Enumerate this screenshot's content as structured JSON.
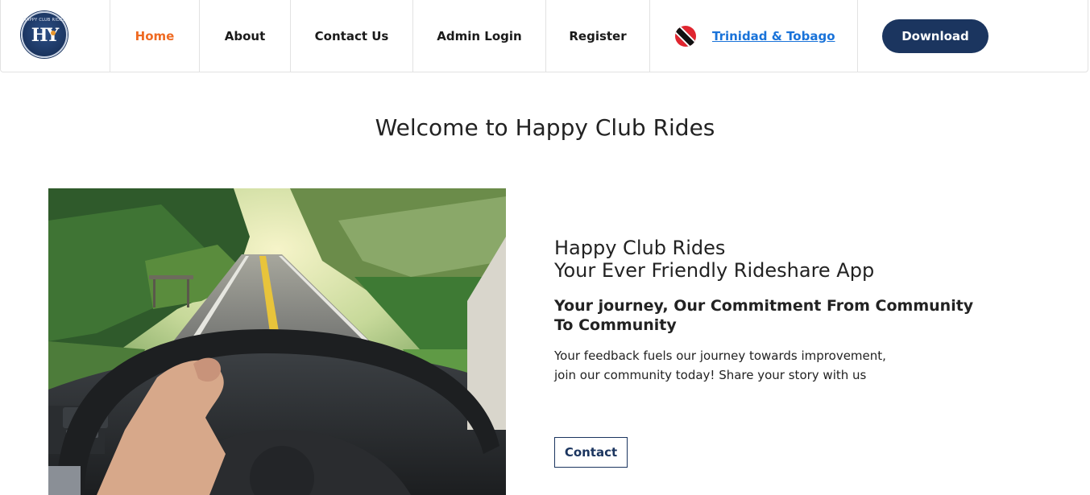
{
  "brand": {
    "logo_icon": "happy-club-rides-logo",
    "logo_ring_text": "HAPPY CLUB RIDES",
    "logo_monogram": "HY"
  },
  "nav": {
    "items": [
      {
        "label": "Home",
        "active": true
      },
      {
        "label": "About"
      },
      {
        "label": "Contact Us"
      },
      {
        "label": "Admin Login"
      },
      {
        "label": "Register"
      }
    ],
    "country": {
      "label": "Trinidad & Tobago",
      "flag_icon": "trinidad-tobago-flag-icon"
    },
    "download_label": "Download"
  },
  "hero": {
    "title": "Welcome to Happy Club Rides",
    "image": "road-through-windshield-with-hand-on-steering-wheel",
    "heading_line1": "Happy Club Rides",
    "heading_line2": "Your Ever Friendly Rideshare App",
    "subheading": "Your journey, Our Commitment From Community To Community",
    "body_line1": "Your feedback fuels our journey towards improvement,",
    "body_line2": "join our community today! Share your story with us",
    "contact_label": "Contact"
  },
  "colors": {
    "active_nav": "#ef6a22",
    "link": "#1a73d9",
    "primary_navy": "#1b355f"
  }
}
